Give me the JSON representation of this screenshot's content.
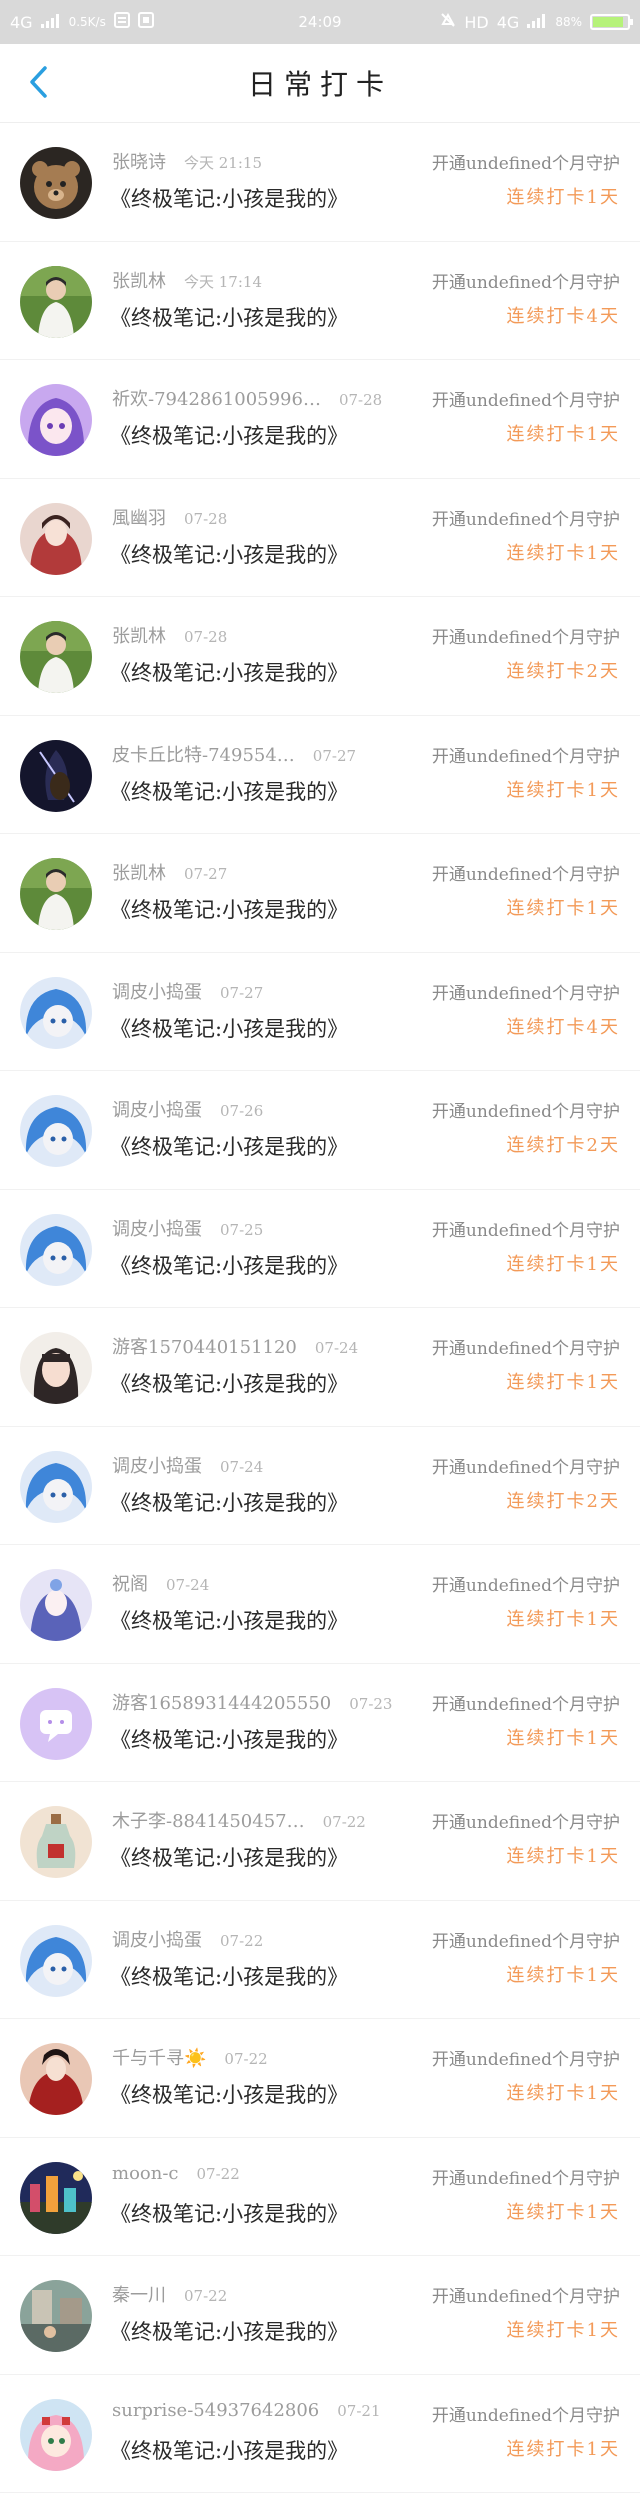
{
  "status_bar": {
    "network": "4G",
    "speed": "0.5K/s",
    "time": "24:09",
    "hd": "HD",
    "network2": "4G",
    "battery_percent": "88%",
    "battery_level": 0.88
  },
  "header": {
    "title": "日常打卡"
  },
  "entries": [
    {
      "name": "张晓诗",
      "time": "今天 21:15",
      "book": "《终极笔记:小孩是我的》",
      "guard": "开通undefined个月守护",
      "streak": "连续打卡1天",
      "avatar": "teddy-bear"
    },
    {
      "name": "张凯林",
      "time": "今天 17:14",
      "book": "《终极笔记:小孩是我的》",
      "guard": "开通undefined个月守护",
      "streak": "连续打卡4天",
      "avatar": "person-green"
    },
    {
      "name": "祈欢-7942861005996…",
      "time": "07-28",
      "book": "《终极笔记:小孩是我的》",
      "guard": "开通undefined个月守护",
      "streak": "连续打卡1天",
      "avatar": "anime-purple"
    },
    {
      "name": "風幽羽",
      "time": "07-28",
      "book": "《终极笔记:小孩是我的》",
      "guard": "开通undefined个月守护",
      "streak": "连续打卡1天",
      "avatar": "anime-red"
    },
    {
      "name": "张凯林",
      "time": "07-28",
      "book": "《终极笔记:小孩是我的》",
      "guard": "开通undefined个月守护",
      "streak": "连续打卡2天",
      "avatar": "person-green"
    },
    {
      "name": "皮卡丘比特-749554…",
      "time": "07-27",
      "book": "《终极笔记:小孩是我的》",
      "guard": "开通undefined个月守护",
      "streak": "连续打卡1天",
      "avatar": "dark-violin"
    },
    {
      "name": "张凯林",
      "time": "07-27",
      "book": "《终极笔记:小孩是我的》",
      "guard": "开通undefined个月守护",
      "streak": "连续打卡1天",
      "avatar": "person-green"
    },
    {
      "name": "调皮小捣蛋",
      "time": "07-27",
      "book": "《终极笔记:小孩是我的》",
      "guard": "开通undefined个月守护",
      "streak": "连续打卡4天",
      "avatar": "anime-blue"
    },
    {
      "name": "调皮小捣蛋",
      "time": "07-26",
      "book": "《终极笔记:小孩是我的》",
      "guard": "开通undefined个月守护",
      "streak": "连续打卡2天",
      "avatar": "anime-blue"
    },
    {
      "name": "调皮小捣蛋",
      "time": "07-25",
      "book": "《终极笔记:小孩是我的》",
      "guard": "开通undefined个月守护",
      "streak": "连续打卡1天",
      "avatar": "anime-blue"
    },
    {
      "name": "游客1570440151120",
      "time": "07-24",
      "book": "《终极笔记:小孩是我的》",
      "guard": "开通undefined个月守护",
      "streak": "连续打卡1天",
      "avatar": "girl-photo"
    },
    {
      "name": "调皮小捣蛋",
      "time": "07-24",
      "book": "《终极笔记:小孩是我的》",
      "guard": "开通undefined个月守护",
      "streak": "连续打卡2天",
      "avatar": "anime-blue"
    },
    {
      "name": "祝阁",
      "time": "07-24",
      "book": "《终极笔记:小孩是我的》",
      "guard": "开通undefined个月守护",
      "streak": "连续打卡1天",
      "avatar": "anime-lavender"
    },
    {
      "name": "游客1658931444205550",
      "time": "07-23",
      "book": "《终极笔记:小孩是我的》",
      "guard": "开通undefined个月守护",
      "streak": "连续打卡1天",
      "avatar": "chat-bubble"
    },
    {
      "name": "木子李-8841450457…",
      "time": "07-22",
      "book": "《终极笔记:小孩是我的》",
      "guard": "开通undefined个月守护",
      "streak": "连续打卡1天",
      "avatar": "bottle"
    },
    {
      "name": "调皮小捣蛋",
      "time": "07-22",
      "book": "《终极笔记:小孩是我的》",
      "guard": "开通undefined个月守护",
      "streak": "连续打卡1天",
      "avatar": "anime-blue"
    },
    {
      "name": "千与千寻☀️",
      "time": "07-22",
      "book": "《终极笔记:小孩是我的》",
      "guard": "开通undefined个月守护",
      "streak": "连续打卡1天",
      "avatar": "red-costume"
    },
    {
      "name": "moon-c",
      "time": "07-22",
      "book": "《终极笔记:小孩是我的》",
      "guard": "开通undefined个月守护",
      "streak": "连续打卡1天",
      "avatar": "city-night"
    },
    {
      "name": "秦一川",
      "time": "07-22",
      "book": "《终极笔记:小孩是我的》",
      "guard": "开通undefined个月守护",
      "streak": "连续打卡1天",
      "avatar": "street-photo"
    },
    {
      "name": "surprise-54937642806",
      "time": "07-21",
      "book": "《终极笔记:小孩是我的》",
      "guard": "开通undefined个月守护",
      "streak": "连续打卡1天",
      "avatar": "anime-pink"
    }
  ],
  "colors": {
    "accent": "#f39a58",
    "back": "#2a9fe0",
    "statusbar": "#d9d9d9"
  }
}
